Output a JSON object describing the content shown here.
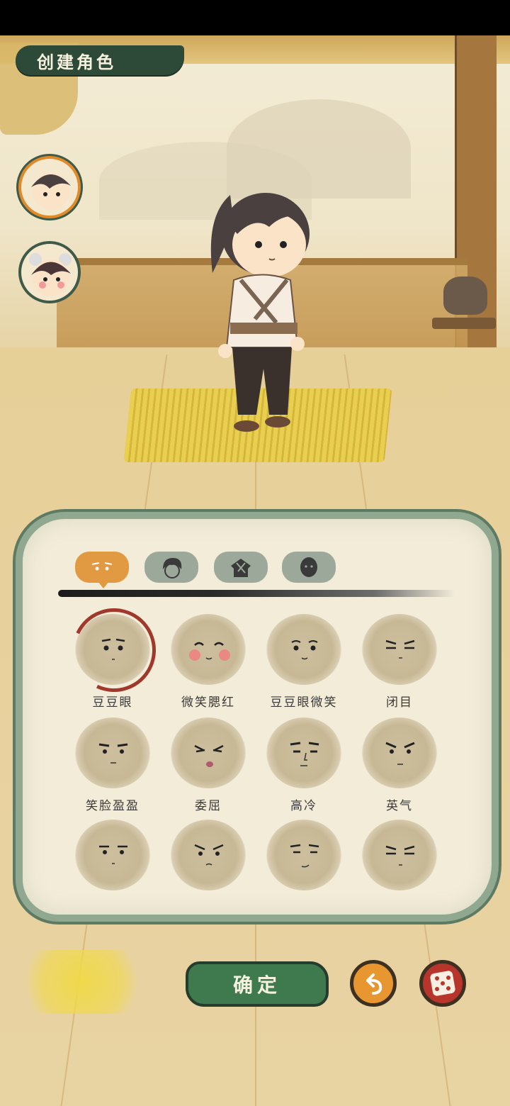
{
  "header": {
    "title": "创建角色"
  },
  "avatars": [
    {
      "name": "male-avatar",
      "selected": true
    },
    {
      "name": "female-avatar",
      "selected": false
    }
  ],
  "tabs": [
    {
      "icon": "face-expression-icon",
      "active": true
    },
    {
      "icon": "hair-icon",
      "active": false
    },
    {
      "icon": "clothes-icon",
      "active": false
    },
    {
      "icon": "skin-icon",
      "active": false
    }
  ],
  "faces": {
    "row1": [
      "豆豆眼",
      "微笑腮红",
      "豆豆眼微笑",
      "闭目"
    ],
    "row2": [
      "笑脸盈盈",
      "委屈",
      "高冷",
      "英气"
    ],
    "selected": "豆豆眼"
  },
  "buttons": {
    "confirm": "确定",
    "undo_icon": "undo-arrow-icon",
    "random_icon": "dice-icon"
  },
  "colors": {
    "accent_orange": "#e29a42",
    "confirm_green": "#3f7a4e",
    "panel_border": "#8fa88f",
    "ribbon": "#2c4a37"
  }
}
